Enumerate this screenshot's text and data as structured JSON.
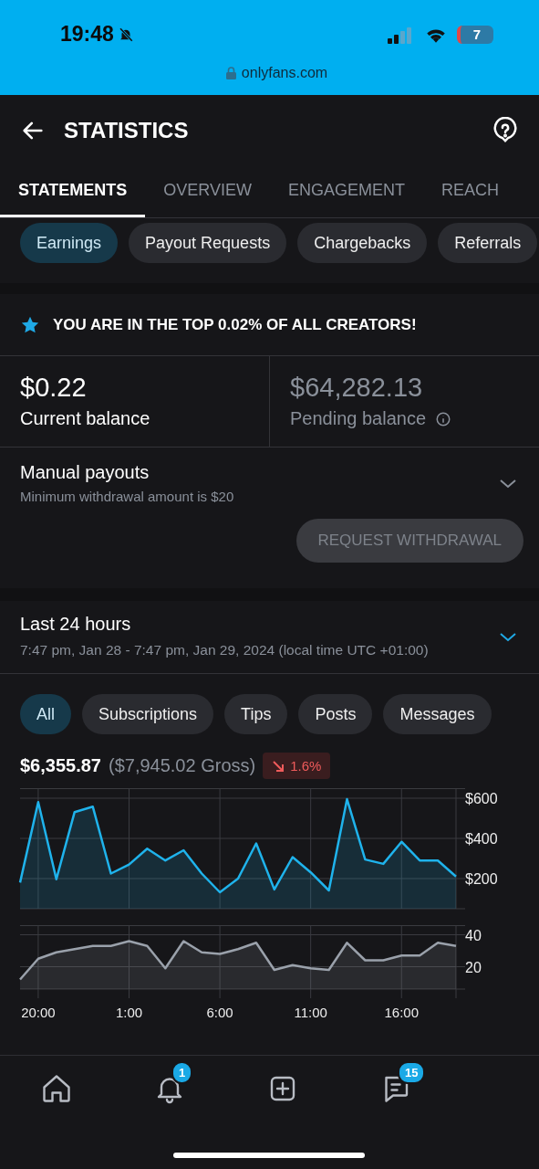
{
  "status_bar": {
    "time": "19:48",
    "battery": "7",
    "url": "onlyfans.com"
  },
  "header": {
    "title": "STATISTICS"
  },
  "tabs": [
    {
      "label": "STATEMENTS",
      "selected": true
    },
    {
      "label": "OVERVIEW",
      "selected": false
    },
    {
      "label": "ENGAGEMENT",
      "selected": false
    },
    {
      "label": "REACH",
      "selected": false
    }
  ],
  "statement_types": [
    {
      "label": "Earnings",
      "selected": true
    },
    {
      "label": "Payout Requests",
      "selected": false
    },
    {
      "label": "Chargebacks",
      "selected": false
    },
    {
      "label": "Referrals",
      "selected": false
    }
  ],
  "banner": "YOU ARE IN THE TOP 0.02% OF ALL CREATORS!",
  "balances": [
    {
      "amount": "$0.22",
      "label": "Current balance",
      "info": false
    },
    {
      "amount": "$64,282.13",
      "label": "Pending balance",
      "info": true
    }
  ],
  "payouts": {
    "title": "Manual payouts",
    "subtitle": "Minimum withdrawal amount is $20",
    "button": "REQUEST WITHDRAWAL",
    "button_disabled": true
  },
  "period": {
    "title": "Last 24 hours",
    "range": "7:47 pm, Jan 28 - 7:47 pm, Jan 29, 2024 (local time UTC +01:00)"
  },
  "filters": [
    {
      "label": "All",
      "selected": true
    },
    {
      "label": "Subscriptions",
      "selected": false
    },
    {
      "label": "Tips",
      "selected": false
    },
    {
      "label": "Posts",
      "selected": false
    },
    {
      "label": "Messages",
      "selected": false
    }
  ],
  "summary": {
    "net": "$6,355.87",
    "gross": "($7,945.02 Gross)",
    "change": "1.6%",
    "decrease": true
  },
  "earnings_chart": {
    "chart_data": {
      "type": "area",
      "categories": [
        null,
        null,
        null,
        null,
        null,
        null,
        null,
        null,
        null,
        null,
        null,
        null,
        null,
        null,
        null,
        null,
        null,
        null,
        null,
        null,
        null,
        null,
        null,
        null,
        null
      ],
      "ylim": [
        50,
        650
      ],
      "grid": true,
      "yticks": [
        {
          "value": 200,
          "label": "$200"
        },
        {
          "value": 400,
          "label": "$400"
        },
        {
          "value": 600,
          "label": "$600"
        }
      ],
      "series": [
        {
          "color": "#1fb3ec",
          "values": [
            180,
            581,
            197,
            531,
            558,
            225,
            270,
            349,
            290,
            341,
            225,
            132,
            200,
            375,
            146,
            307,
            231,
            141,
            595,
            295,
            273,
            383,
            290,
            290,
            210
          ]
        }
      ]
    }
  },
  "count_chart": {
    "chart_data": {
      "type": "area",
      "categories": [
        null,
        "20:00",
        null,
        null,
        null,
        null,
        "1:00",
        null,
        null,
        null,
        null,
        "6:00",
        null,
        null,
        null,
        null,
        "11:00",
        null,
        null,
        null,
        null,
        "16:00",
        null,
        null,
        null
      ],
      "ylim": [
        6,
        46
      ],
      "grid": true,
      "yticks": [
        20,
        40
      ],
      "series": [
        {
          "color": "#9aa1ab",
          "values": [
            12,
            25,
            29,
            31,
            33,
            33,
            36,
            33,
            19,
            36,
            29,
            28,
            31,
            35,
            18,
            21,
            19,
            18,
            35,
            24,
            24,
            27,
            27,
            35,
            33
          ]
        }
      ]
    }
  },
  "nav": [
    {
      "kind": "home"
    },
    {
      "kind": "bell",
      "badge": "1"
    },
    {
      "kind": "add"
    },
    {
      "kind": "chat",
      "badge": "15"
    }
  ]
}
